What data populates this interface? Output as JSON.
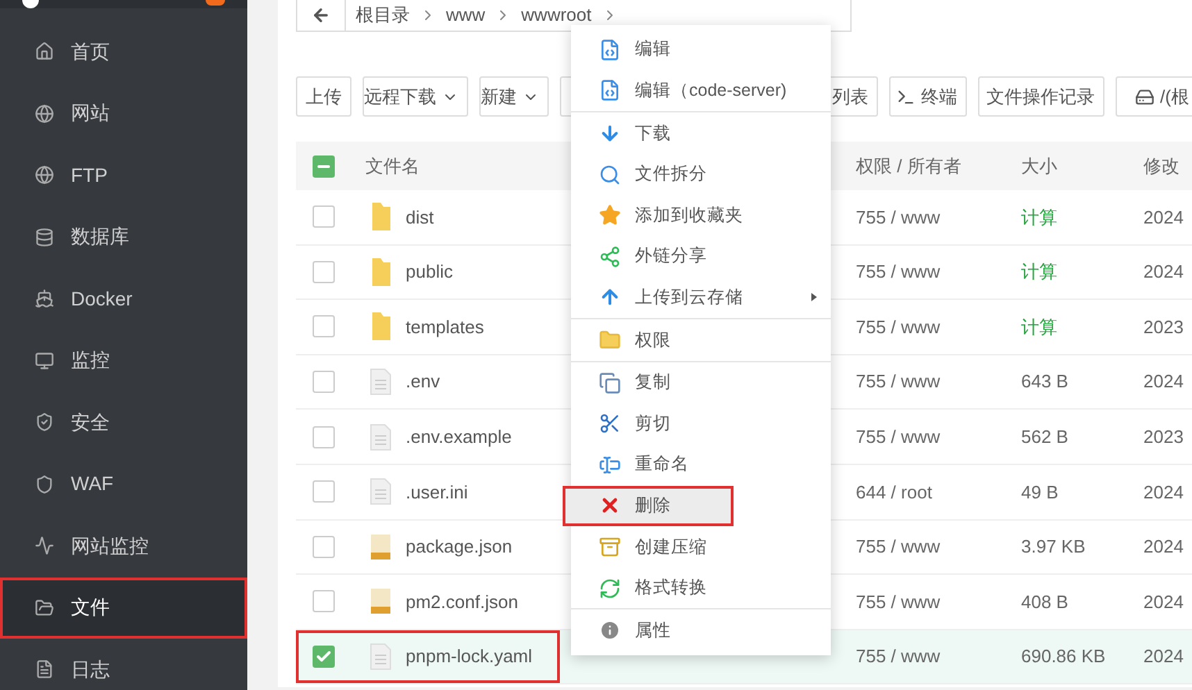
{
  "sidebar": {
    "items": [
      {
        "label": "首页",
        "selected": false,
        "annotated": false
      },
      {
        "label": "网站",
        "selected": false,
        "annotated": false
      },
      {
        "label": "FTP",
        "selected": false,
        "annotated": false
      },
      {
        "label": "数据库",
        "selected": false,
        "annotated": false
      },
      {
        "label": "Docker",
        "selected": false,
        "annotated": false
      },
      {
        "label": "监控",
        "selected": false,
        "annotated": false
      },
      {
        "label": "安全",
        "selected": false,
        "annotated": false
      },
      {
        "label": "WAF",
        "selected": false,
        "annotated": false
      },
      {
        "label": "网站监控",
        "selected": false,
        "annotated": false
      },
      {
        "label": "文件",
        "selected": true,
        "annotated": true
      },
      {
        "label": "日志",
        "selected": false,
        "annotated": false
      }
    ]
  },
  "breadcrumb": [
    "根目录",
    "www",
    "wwwroot"
  ],
  "toolbar": [
    {
      "label": "上传",
      "dropdown": false
    },
    {
      "label": "远程下载",
      "dropdown": true
    },
    {
      "label": "新建",
      "dropdown": true
    },
    {
      "label": "列表",
      "dropdown": false
    },
    {
      "label": "终端",
      "dropdown": false
    },
    {
      "label": "文件操作记录",
      "dropdown": false
    },
    {
      "label": "/(根",
      "dropdown": false
    }
  ],
  "table": {
    "select_all": {
      "indeterminate": true
    },
    "columns": [
      "文件名",
      "权限 / 所有者",
      "大小",
      "修改"
    ],
    "rows": [
      {
        "name": "dist",
        "kind": "folder",
        "perm": "755 / www",
        "size": "计算",
        "size_is_link": true,
        "modified": "2024",
        "checked": false,
        "annotated": false
      },
      {
        "name": "public",
        "kind": "folder",
        "perm": "755 / www",
        "size": "计算",
        "size_is_link": true,
        "modified": "2024",
        "checked": false,
        "annotated": false
      },
      {
        "name": "templates",
        "kind": "folder",
        "perm": "755 / www",
        "size": "计算",
        "size_is_link": true,
        "modified": "2023",
        "checked": false,
        "annotated": false
      },
      {
        "name": ".env",
        "kind": "file",
        "perm": "755 / www",
        "size": "643 B",
        "size_is_link": false,
        "modified": "2024",
        "checked": false,
        "annotated": false
      },
      {
        "name": ".env.example",
        "kind": "file",
        "perm": "755 / www",
        "size": "562 B",
        "size_is_link": false,
        "modified": "2023",
        "checked": false,
        "annotated": false
      },
      {
        "name": ".user.ini",
        "kind": "file",
        "perm": "644 / root",
        "size": "49 B",
        "size_is_link": false,
        "modified": "2024",
        "checked": false,
        "annotated": false
      },
      {
        "name": "package.json",
        "kind": "json",
        "perm": "755 / www",
        "size": "3.97 KB",
        "size_is_link": false,
        "modified": "2024",
        "checked": false,
        "annotated": false
      },
      {
        "name": "pm2.conf.json",
        "kind": "json",
        "perm": "755 / www",
        "size": "408 B",
        "size_is_link": false,
        "modified": "2024",
        "checked": false,
        "annotated": false
      },
      {
        "name": "pnpm-lock.yaml",
        "kind": "file",
        "perm": "755 / www",
        "size": "690.86 KB",
        "size_is_link": false,
        "modified": "2024",
        "checked": true,
        "annotated": true
      }
    ]
  },
  "context_menu": {
    "groups": [
      [
        {
          "label": "编辑",
          "submenu": false,
          "selected": false,
          "annotated": false
        },
        {
          "label": "编辑（code-server)",
          "submenu": false,
          "selected": false,
          "annotated": false
        }
      ],
      [
        {
          "label": "下载",
          "submenu": false,
          "selected": false,
          "annotated": false
        },
        {
          "label": "文件拆分",
          "submenu": false,
          "selected": false,
          "annotated": false
        },
        {
          "label": "添加到收藏夹",
          "submenu": false,
          "selected": false,
          "annotated": false
        },
        {
          "label": "外链分享",
          "submenu": false,
          "selected": false,
          "annotated": false
        },
        {
          "label": "上传到云存储",
          "submenu": true,
          "selected": false,
          "annotated": false
        }
      ],
      [
        {
          "label": "权限",
          "submenu": false,
          "selected": false,
          "annotated": false
        }
      ],
      [
        {
          "label": "复制",
          "submenu": false,
          "selected": false,
          "annotated": false
        },
        {
          "label": "剪切",
          "submenu": false,
          "selected": false,
          "annotated": false
        },
        {
          "label": "重命名",
          "submenu": false,
          "selected": false,
          "annotated": false
        },
        {
          "label": "删除",
          "submenu": false,
          "selected": true,
          "annotated": true
        },
        {
          "label": "创建压缩",
          "submenu": false,
          "selected": false,
          "annotated": false
        },
        {
          "label": "格式转换",
          "submenu": false,
          "selected": false,
          "annotated": false
        }
      ],
      [
        {
          "label": "属性",
          "submenu": false,
          "selected": false,
          "annotated": false
        }
      ]
    ]
  }
}
